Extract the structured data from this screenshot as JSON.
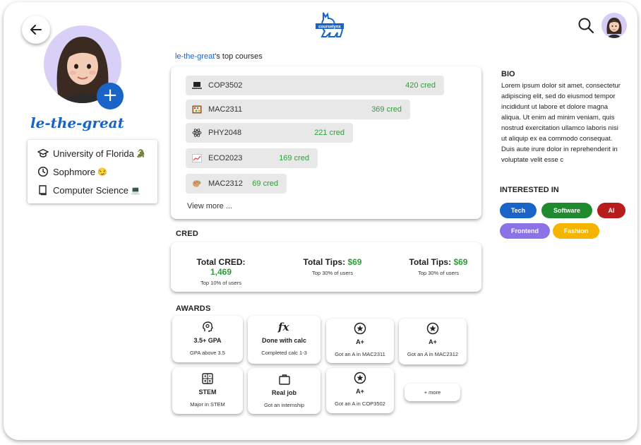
{
  "header": {
    "logo_text": "courselynx"
  },
  "profile": {
    "username": "le-the-great",
    "university": "University of Florida",
    "university_emoji": "🐊",
    "year": "Sophmore",
    "year_emoji": "😏",
    "major": "Computer Science",
    "major_emoji": "💻",
    "add_label": "+"
  },
  "top_courses": {
    "title_user": "le-the-great",
    "title_suffix": "'s top courses",
    "items": [
      {
        "code": "COP3502",
        "cred": "420 cred",
        "icon": "laptop-icon"
      },
      {
        "code": "MAC2311",
        "cred": "369 cred",
        "icon": "abacus-icon"
      },
      {
        "code": "PHY2048",
        "cred": "221 cred",
        "icon": "atom-icon"
      },
      {
        "code": "ECO2023",
        "cred": "169 cred",
        "icon": "chart-icon"
      },
      {
        "code": "MAC2312",
        "cred": "69 cred",
        "icon": "palette-icon"
      }
    ],
    "view_more": "View more ..."
  },
  "cred": {
    "section_title": "CRED",
    "stats": [
      {
        "label": "Total CRED:",
        "value": "1,469",
        "sub": "Top 10% of users"
      },
      {
        "label": "Total Tips:",
        "value": "$69",
        "sub": "Top 30% of users"
      },
      {
        "label": "Total Tips:",
        "value": "$69",
        "sub": "Top 30% of users"
      }
    ]
  },
  "awards": {
    "section_title": "AWARDS",
    "items": [
      {
        "title": "3.5+ GPA",
        "sub": "GPA above 3.5",
        "icon": "brain-icon"
      },
      {
        "title": "Done with calc",
        "sub": "Completed calc 1-3",
        "icon": "function-icon"
      },
      {
        "title": "A+",
        "sub": "Got an A in MAC2311",
        "icon": "star-circle-icon"
      },
      {
        "title": "A+",
        "sub": "Got an A in MAC2312",
        "icon": "star-circle-icon"
      },
      {
        "title": "STEM",
        "sub": "Major in STEM",
        "icon": "calculator-icon"
      },
      {
        "title": "Real job",
        "sub": "Got an internship",
        "icon": "briefcase-icon"
      },
      {
        "title": "A+",
        "sub": "Got an A in COP3502",
        "icon": "star-circle-icon"
      }
    ],
    "more": "+ more"
  },
  "bio": {
    "title": "BIO",
    "text": "Lorem ipsum dolor sit amet, consectetur adipiscing elit, sed do eiusmod tempor incididunt ut labore et dolore magna aliqua. Ut enim ad minim veniam, quis nostrud exercitation ullamco laboris nisi ut aliquip ex ea commodo consequat. Duis aute irure dolor in reprehenderit in voluptate velit esse c"
  },
  "interests": {
    "title": "INTERESTED IN",
    "chips": [
      {
        "label": "Tech",
        "color": "#1a64c8"
      },
      {
        "label": "Software",
        "color": "#1f8a2e"
      },
      {
        "label": "AI",
        "color": "#b81d1d"
      },
      {
        "label": "Frontend",
        "color": "#8b73e6"
      },
      {
        "label": "Fashion",
        "color": "#f4b400"
      }
    ]
  }
}
